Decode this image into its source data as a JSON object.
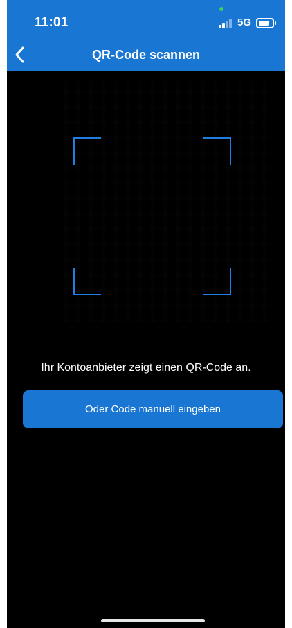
{
  "status_bar": {
    "time": "11:01",
    "network": "5G",
    "signal_icon": "signal-bars-icon",
    "battery_icon": "battery-icon"
  },
  "nav": {
    "title": "QR-Code scannen",
    "back_icon": "chevron-left-icon"
  },
  "scanner": {
    "hint": "Ihr Kontoanbieter zeigt einen QR-Code an.",
    "manual_button_label": "Oder Code manuell eingeben"
  },
  "colors": {
    "accent": "#1976d2",
    "frame": "#1e7fe0",
    "background": "#000000",
    "text": "#ffffff"
  }
}
